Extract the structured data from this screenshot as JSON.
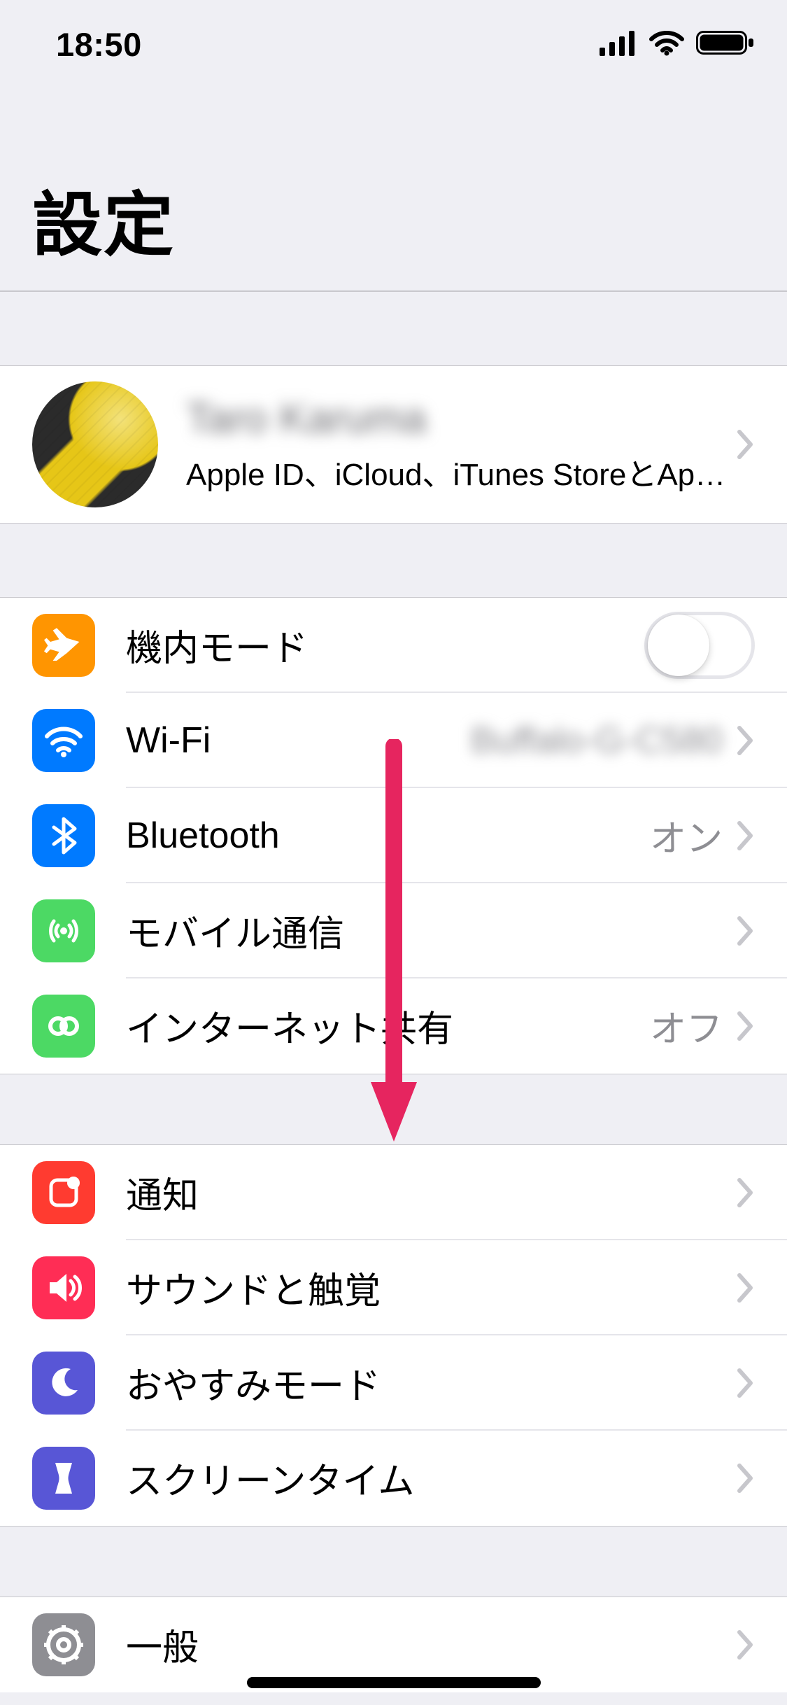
{
  "statusbar": {
    "time": "18:50"
  },
  "title": "設定",
  "profile": {
    "name": "Taro Karuma",
    "subtitle": "Apple ID、iCloud、iTunes StoreとApp S..."
  },
  "group_connectivity": [
    {
      "icon": "airplane-icon",
      "color": "c-orange",
      "label": "機内モード",
      "type": "toggle",
      "on": false
    },
    {
      "icon": "wifi-icon",
      "color": "c-blue",
      "label": "Wi-Fi",
      "type": "nav",
      "value": "Buffalo-G-C580"
    },
    {
      "icon": "bluetooth-icon",
      "color": "c-bt",
      "label": "Bluetooth",
      "type": "nav",
      "value": "オン"
    },
    {
      "icon": "cellular-icon",
      "color": "c-green",
      "label": "モバイル通信",
      "type": "nav"
    },
    {
      "icon": "hotspot-icon",
      "color": "c-green",
      "label": "インターネット共有",
      "type": "nav",
      "value": "オフ"
    }
  ],
  "group_notifications": [
    {
      "icon": "notification-icon",
      "color": "c-red",
      "label": "通知",
      "type": "nav"
    },
    {
      "icon": "sound-icon",
      "color": "c-pink",
      "label": "サウンドと触覚",
      "type": "nav"
    },
    {
      "icon": "dnd-icon",
      "color": "c-indigo",
      "label": "おやすみモード",
      "type": "nav"
    },
    {
      "icon": "screentime-icon",
      "color": "c-indigo",
      "label": "スクリーンタイム",
      "type": "nav"
    }
  ],
  "group_general": [
    {
      "icon": "gear-icon",
      "color": "c-gray",
      "label": "一般",
      "type": "nav"
    }
  ]
}
